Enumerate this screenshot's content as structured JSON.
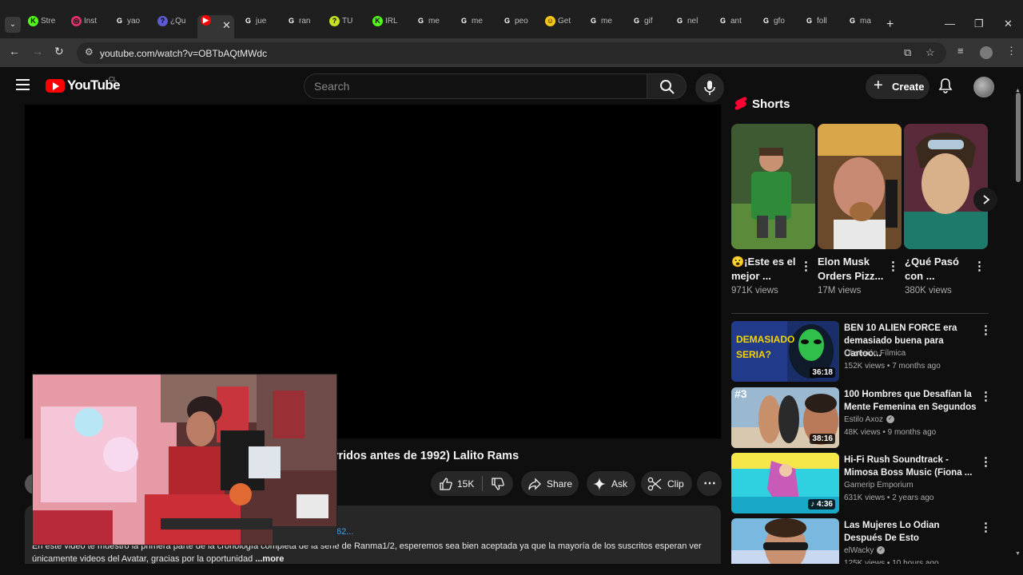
{
  "browser": {
    "tabs": [
      {
        "label": "Stre",
        "favicon": "kick-icon",
        "color": "#53fc18"
      },
      {
        "label": "Inst",
        "favicon": "instagram-icon",
        "color": "#e1306c"
      },
      {
        "label": "yao",
        "favicon": "google-icon",
        "color": "#ffffff"
      },
      {
        "label": "¿Qu",
        "favicon": "app-icon",
        "color": "#5b5bd6"
      },
      {
        "label": "",
        "favicon": "youtube-icon",
        "color": "#ff0000",
        "active": true
      },
      {
        "label": "jue",
        "favicon": "google-icon",
        "color": "#ffffff"
      },
      {
        "label": "ran",
        "favicon": "google-icon",
        "color": "#ffffff"
      },
      {
        "label": "TU",
        "favicon": "app-icon",
        "color": "#c6e024"
      },
      {
        "label": "IRL",
        "favicon": "kick-icon",
        "color": "#53fc18"
      },
      {
        "label": "me",
        "favicon": "google-icon",
        "color": "#ffffff"
      },
      {
        "label": "me",
        "favicon": "google-icon",
        "color": "#ffffff"
      },
      {
        "label": "peo",
        "favicon": "google-icon",
        "color": "#ffffff"
      },
      {
        "label": "Get",
        "favicon": "emoji-icon",
        "color": "#f5c518"
      },
      {
        "label": "me",
        "favicon": "google-icon",
        "color": "#ffffff"
      },
      {
        "label": "gif",
        "favicon": "google-icon",
        "color": "#ffffff"
      },
      {
        "label": "nel",
        "favicon": "google-icon",
        "color": "#ffffff"
      },
      {
        "label": "ant",
        "favicon": "google-icon",
        "color": "#ffffff"
      },
      {
        "label": "gfo",
        "favicon": "google-icon",
        "color": "#ffffff"
      },
      {
        "label": "foll",
        "favicon": "google-icon",
        "color": "#ffffff"
      },
      {
        "label": "ma",
        "favicon": "google-icon",
        "color": "#ffffff"
      }
    ],
    "url": "youtube.com/watch?v=OBTbAQtMWdc"
  },
  "youtube": {
    "logo_text": "YouTube",
    "country_code": "CL",
    "search_placeholder": "Search",
    "create_label": "Create"
  },
  "video": {
    "title_visible": "urridos antes de 1992) Lalito Rams",
    "likes": "15K",
    "share_label": "Share",
    "ask_label": "Ask",
    "clip_label": "Clip",
    "desc_meta": "62...",
    "description": "En este video te muestro la primera parte de la cronología completa de la serie de Ranma1/2, esperemos sea bien aceptada ya que la mayoría de los suscritos esperan ver únicamente videos del Avatar, gracias por la oportunidad",
    "more_label": "...more"
  },
  "sidebar": {
    "shorts_label": "Shorts",
    "shorts": [
      {
        "title": "😮¡Este es el mejor ...",
        "views": "971K views"
      },
      {
        "title": "Elon Musk Orders Pizz...",
        "views": "17M views"
      },
      {
        "title": "¿Qué Pasó con ...",
        "views": "380K views"
      }
    ],
    "recommended": [
      {
        "title": "BEN 10 ALIEN FORCE era demasiado buena para Cartoo...",
        "channel": "Obsesión Fílmica",
        "verified": false,
        "meta": "152K views • 7 months ago",
        "duration": "36:18",
        "thumb_text": "DEMASIADO SERIA?"
      },
      {
        "title": "100 Hombres que Desafían la Mente Femenina en Segundos",
        "channel": "Estilo Axoz",
        "verified": true,
        "meta": "48K views • 9 months ago",
        "duration": "38:16",
        "thumb_text": "#3"
      },
      {
        "title": "Hi-Fi Rush Soundtrack - Mimosa Boss Music (Fiona ...",
        "channel": "Gamerip Emporium",
        "verified": false,
        "meta": "631K views • 2 years ago",
        "duration": "♪ 4:36",
        "thumb_text": ""
      },
      {
        "title": "Las Mujeres Lo Odian Después De Esto",
        "channel": "elWacky",
        "verified": true,
        "meta": "125K views • 10 hours ago",
        "duration": "",
        "thumb_text": ""
      }
    ]
  }
}
